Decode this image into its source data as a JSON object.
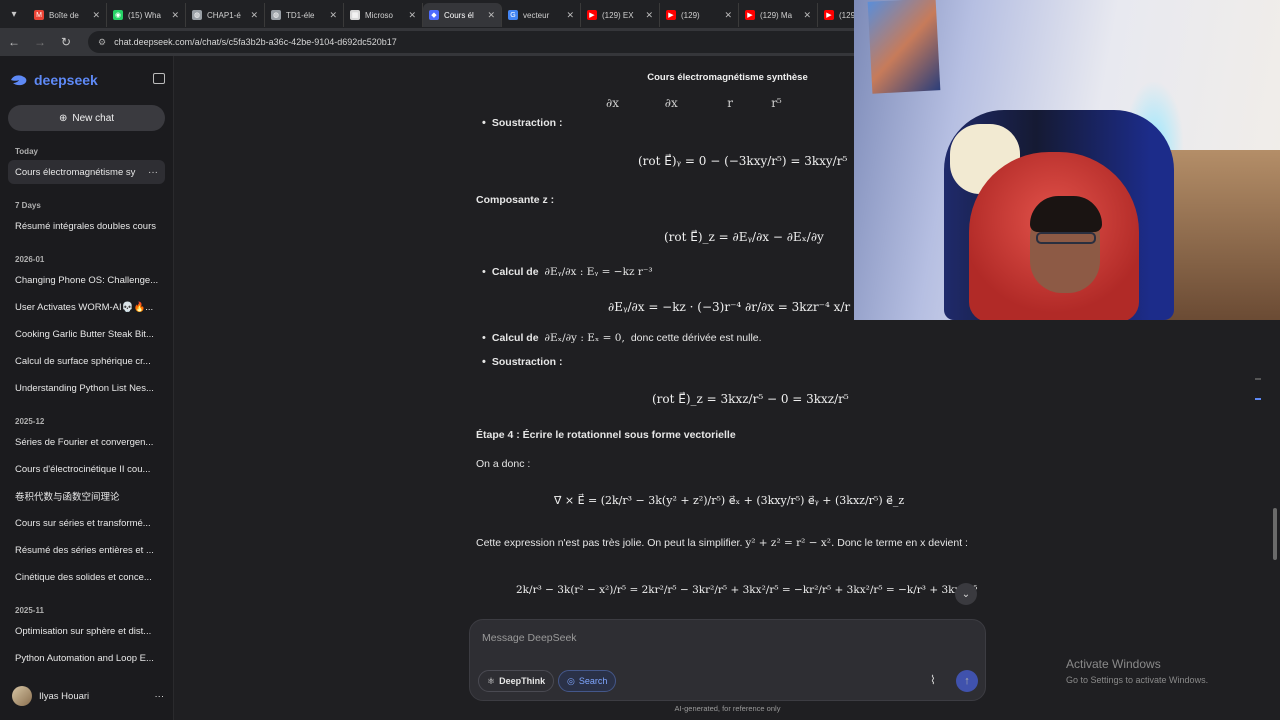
{
  "browser": {
    "tabs": [
      {
        "label": "Boîte de",
        "fav_color": "#ea4335",
        "fav_glyph": "M"
      },
      {
        "label": "(15) Wha",
        "fav_color": "#25d366",
        "fav_glyph": "◉"
      },
      {
        "label": "CHAP1-é",
        "fav_color": "#9aa0a6",
        "fav_glyph": "◍"
      },
      {
        "label": "TD1-éle",
        "fav_color": "#9aa0a6",
        "fav_glyph": "◍"
      },
      {
        "label": "Microso",
        "fav_color": "#d9d9d9",
        "fav_glyph": "▦"
      },
      {
        "label": "Cours él",
        "fav_color": "#4d6bfe",
        "fav_glyph": "◆"
      },
      {
        "label": "vecteur",
        "fav_color": "#4285f4",
        "fav_glyph": "G"
      },
      {
        "label": "(129) EX",
        "fav_color": "#ff0000",
        "fav_glyph": "▶"
      },
      {
        "label": "(129)",
        "fav_color": "#ff0000",
        "fav_glyph": "▶"
      },
      {
        "label": "(129) Ma",
        "fav_color": "#ff0000",
        "fav_glyph": "▶"
      },
      {
        "label": "(129",
        "fav_color": "#ff0000",
        "fav_glyph": "▶"
      }
    ],
    "active_tab_index": 5,
    "url": "chat.deepseek.com/a/chat/s/c5fa3b2b-a36c-42be-9104-d692dc520b17"
  },
  "sidebar": {
    "logo": "deepseek",
    "new_chat": "New chat",
    "sections": [
      {
        "title": "Today",
        "items": [
          "Cours électromagnétisme sy"
        ]
      },
      {
        "title": "7 Days",
        "items": [
          "Résumé intégrales doubles cours"
        ]
      },
      {
        "title": "2026-01",
        "items": [
          "Changing Phone OS: Challenge...",
          "User Activates WORM-AI💀🔥...",
          "Cooking Garlic Butter Steak Bit...",
          "Calcul de surface sphérique cr...",
          "Understanding Python List Nes..."
        ]
      },
      {
        "title": "2025-12",
        "items": [
          "Séries de Fourier et convergen...",
          "Cours d'électrocinétique II cou...",
          "卷积代数与函数空间理论",
          "Cours sur séries et transformé...",
          "Résumé des séries entières et ...",
          "Cinétique des solides et conce..."
        ]
      },
      {
        "title": "2025-11",
        "items": [
          "Optimisation sur sphère et dist...",
          "Python Automation and Loop E..."
        ]
      }
    ],
    "user": "Ilyas Houari"
  },
  "chat": {
    "title": "Cours électromagnétisme synthèse",
    "soustraction_1": "Soustraction :",
    "eq_rot_y": "(rot E⃗)ᵧ = 0 − (−3kxy/r⁵) = 3kxy/r⁵",
    "composante_z": "Composante z :",
    "eq_rot_z_def": "(rot E⃗)_z = ∂Eᵧ/∂x − ∂Eₓ/∂y",
    "calcul_1_label": "Calcul de",
    "calcul_1_math": "∂Eᵧ/∂x : Eᵧ = −kz r⁻³",
    "eq_dEy": "∂Eᵧ/∂x = −kz · (−3)r⁻⁴ ∂r/∂x = 3kzr⁻⁴ x/r = 3kxz/r⁵",
    "calcul_2_label": "Calcul de",
    "calcul_2_math": "∂Eₓ/∂y : Eₓ = 0,",
    "calcul_2_tail": "donc cette dérivée est nulle.",
    "soustraction_2": "Soustraction :",
    "eq_rot_z": "(rot E⃗)_z = 3kxz/r⁵ − 0 = 3kxz/r⁵",
    "etape4": "Étape 4 : Écrire le rotationnel sous forme vectorielle",
    "on_a_donc": "On a donc :",
    "eq_vector": "∇⃗ × E⃗ = (2k/r³ − 3k(y² + z²)/r⁵) e⃗ₓ + (3kxy/r⁵) e⃗ᵧ + (3kxz/r⁵) e⃗_z",
    "simplify_1": "Cette expression n'est pas très jolie. On peut la simplifier.",
    "simplify_math": "y² + z² = r² − x².",
    "simplify_2": "Donc le terme en x",
    "simplify_3": "devient :",
    "eq_final": "2k/r³ − 3k(r² − x²)/r⁵ = 2kr²/r⁵ − 3kr²/r⁵ + 3kx²/r⁵ = −kr²/r⁵ + 3kx²/r⁵ = −k/r³ + 3kx²/r⁵"
  },
  "composer": {
    "placeholder": "Message DeepSeek",
    "deepthink": "DeepThink",
    "search": "Search",
    "disclaimer": "AI-generated, for reference only"
  },
  "windows_notice": {
    "line1": "Activate Windows",
    "line2": "Go to Settings to activate Windows."
  }
}
